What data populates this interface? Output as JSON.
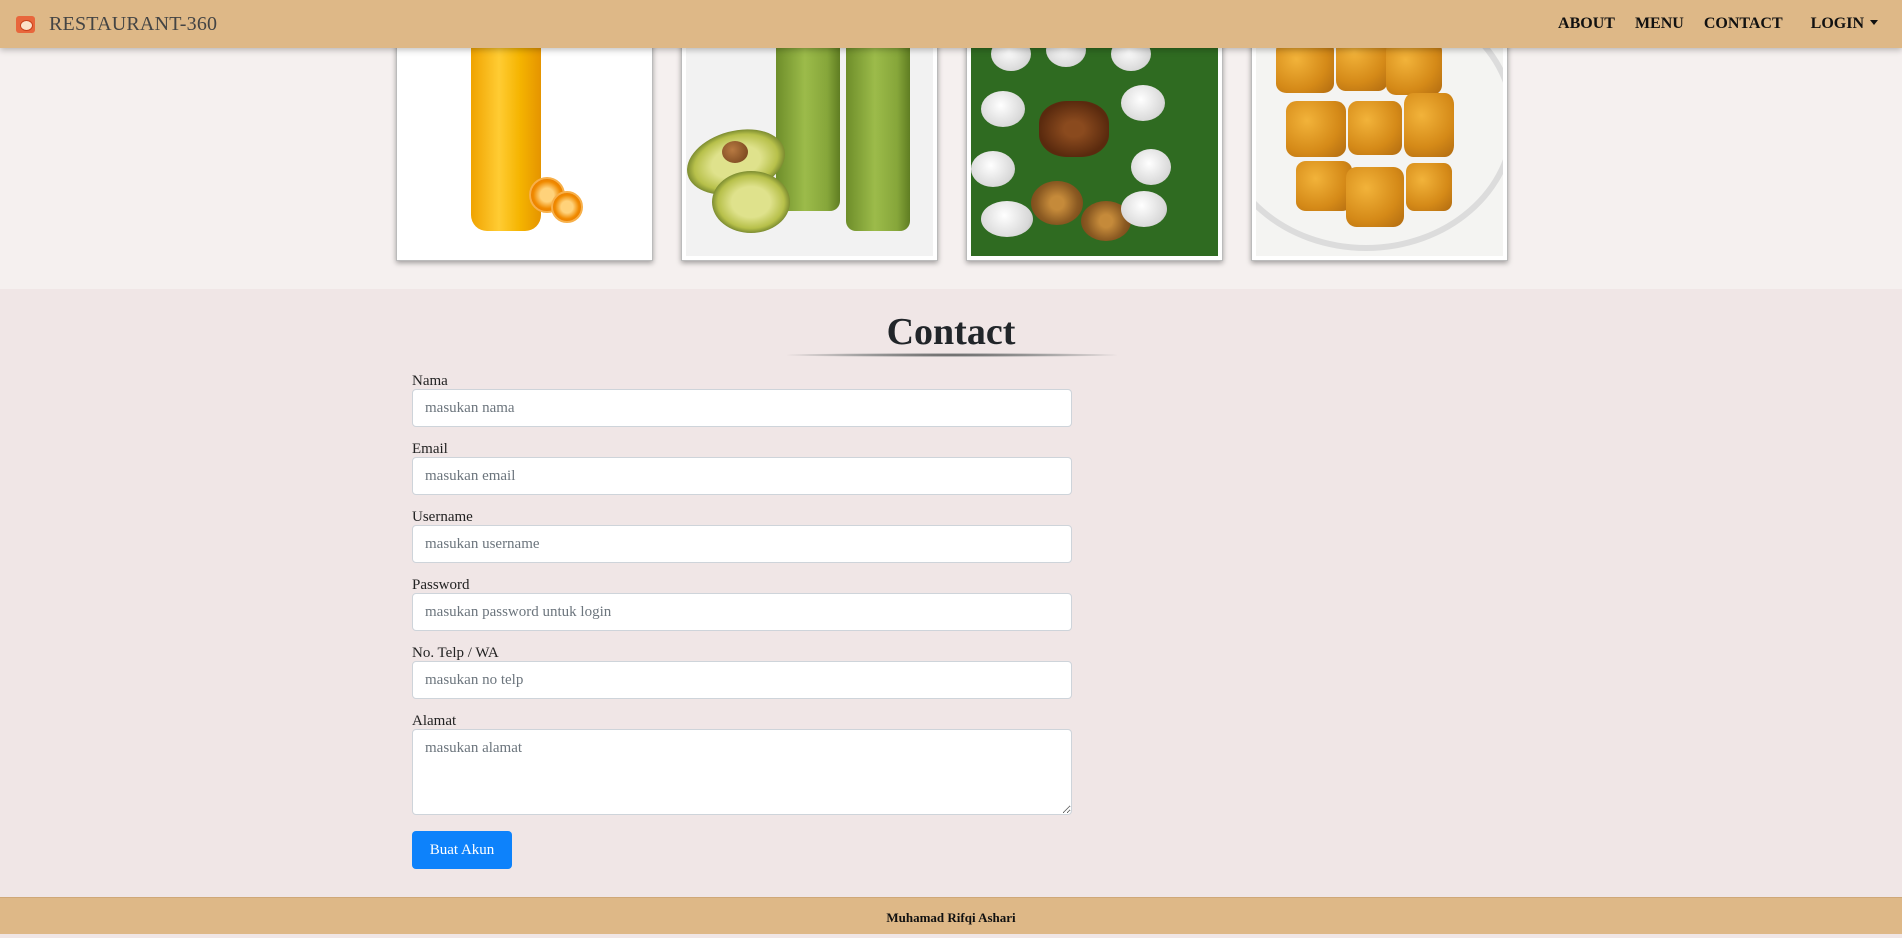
{
  "navbar": {
    "brand": "RESTAURANT-360",
    "links": [
      "ABOUT",
      "MENU",
      "CONTACT"
    ],
    "login_label": "LOGIN"
  },
  "gallery": {
    "images": [
      "orange-juice-image",
      "avocado-juice-image",
      "rice-platter-image",
      "fried-tempe-image"
    ]
  },
  "contact": {
    "title": "Contact",
    "fields": [
      {
        "label": "Nama",
        "placeholder": "masukan nama"
      },
      {
        "label": "Email",
        "placeholder": "masukan email"
      },
      {
        "label": "Username",
        "placeholder": "masukan username"
      },
      {
        "label": "Password",
        "placeholder": "masukan password untuk login"
      },
      {
        "label": "No. Telp / WA",
        "placeholder": "masukan no telp"
      },
      {
        "label": "Alamat",
        "placeholder": "masukan alamat"
      }
    ],
    "submit_label": "Buat Akun"
  },
  "footer": {
    "text": "Muhamad Rifqi Ashari"
  },
  "colors": {
    "navbar_bg": "#deb887",
    "button_bg": "#0d82fb",
    "section_bg": "#f0e6e6"
  }
}
